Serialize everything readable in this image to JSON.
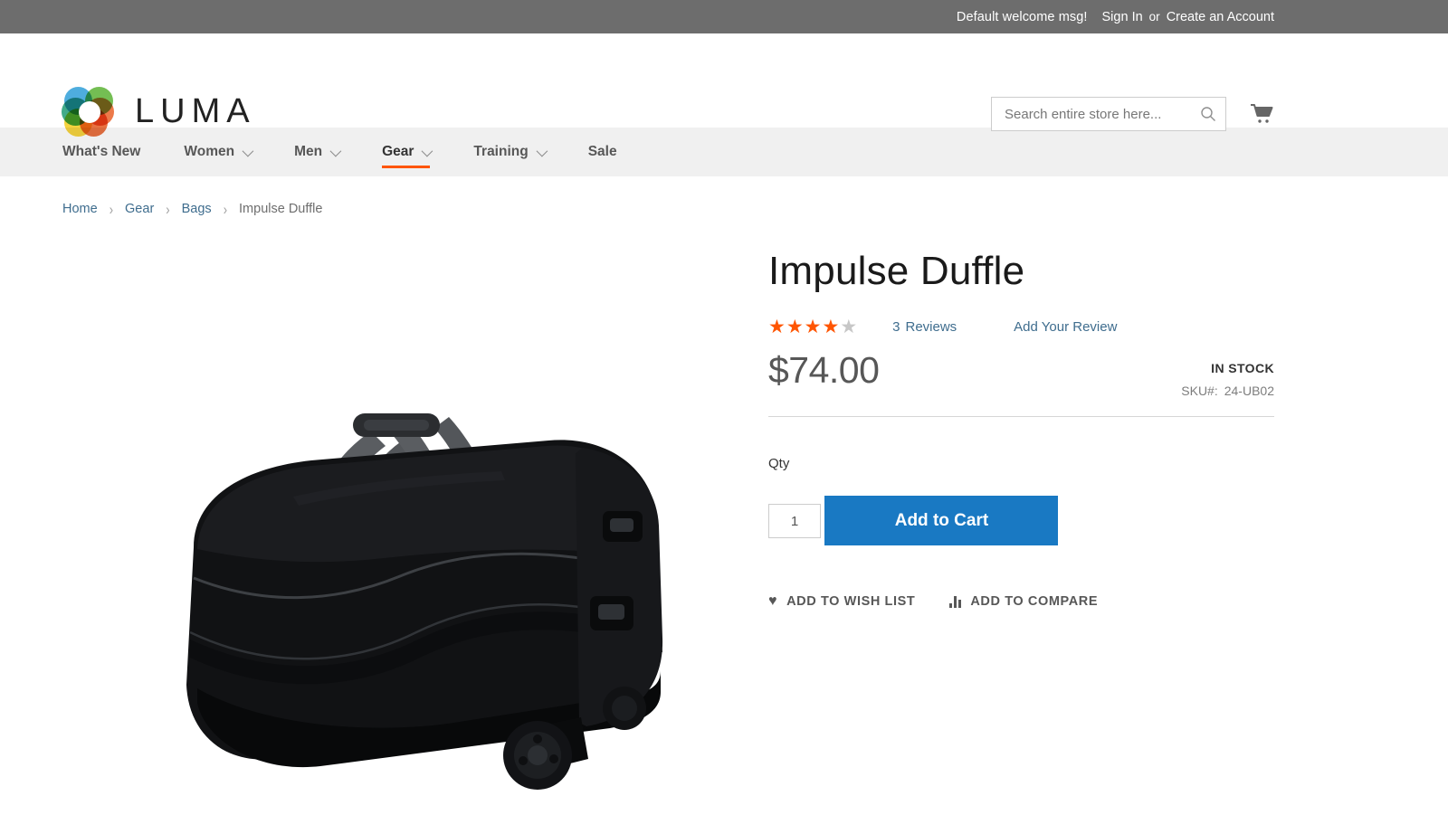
{
  "top_panel": {
    "welcome": "Default welcome msg!",
    "sign_in": "Sign In",
    "or": "or",
    "create_account": "Create an Account"
  },
  "header": {
    "logo_text": "LUMA",
    "logo_icon": "luma-rings-logo",
    "search": {
      "placeholder": "Search entire store here...",
      "value": "",
      "icon": "search-icon"
    },
    "cart": {
      "icon": "shopping-cart-icon"
    }
  },
  "nav": {
    "items": [
      {
        "label": "What's New",
        "has_caret": false,
        "active": false
      },
      {
        "label": "Women",
        "has_caret": true,
        "active": false
      },
      {
        "label": "Men",
        "has_caret": true,
        "active": false
      },
      {
        "label": "Gear",
        "has_caret": true,
        "active": true
      },
      {
        "label": "Training",
        "has_caret": true,
        "active": false
      },
      {
        "label": "Sale",
        "has_caret": false,
        "active": false
      }
    ],
    "active_underline_color": "#ff5501"
  },
  "breadcrumb": {
    "items": [
      {
        "label": "Home",
        "link": true
      },
      {
        "label": "Gear",
        "link": true
      },
      {
        "label": "Bags",
        "link": true
      },
      {
        "label": "Impulse Duffle",
        "link": false
      }
    ],
    "separator": "›"
  },
  "product": {
    "title": "Impulse Duffle",
    "rating": {
      "filled": 4,
      "total": 5,
      "star_glyph": "★"
    },
    "reviews_count": "3",
    "reviews_label": "Reviews",
    "add_review_label": "Add Your Review",
    "price": "$74.00",
    "stock_status": "IN STOCK",
    "sku_label": "SKU#:",
    "sku_value": "24-UB02",
    "qty_label": "Qty",
    "qty_value": "1",
    "add_to_cart_label": "Add to Cart",
    "wishlist_label": "ADD TO WISH LIST",
    "wishlist_icon": "heart-icon",
    "compare_label": "ADD TO COMPARE",
    "compare_icon": "bar-chart-icon",
    "image_alt": "black-rolling-duffle-bag"
  },
  "colors": {
    "top_panel_bg": "#6d6d6d",
    "nav_bg": "#f0f0f0",
    "accent_orange": "#ff5501",
    "primary_blue": "#1979c3",
    "link_blue": "#3f6d8e"
  }
}
